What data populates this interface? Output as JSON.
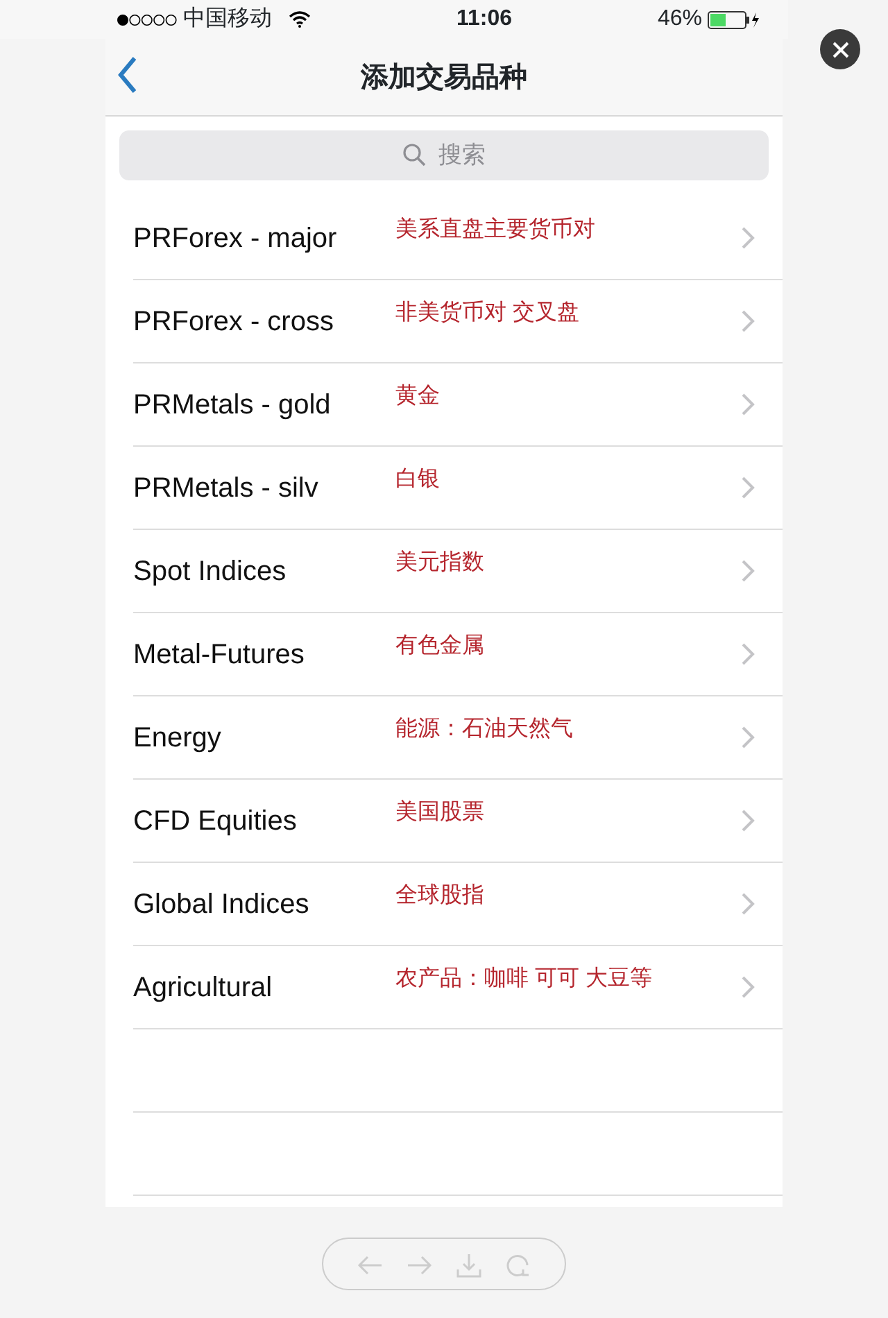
{
  "status_bar": {
    "carrier": "中国移动",
    "time": "11:06",
    "battery": "46%"
  },
  "nav_bar": {
    "title": "添加交易品种"
  },
  "search": {
    "placeholder": "搜索"
  },
  "instruments": [
    {
      "name": "PRForex - major",
      "note": "美系直盘主要货币对"
    },
    {
      "name": "PRForex - cross",
      "note": "非美货币对  交叉盘"
    },
    {
      "name": "PRMetals - gold",
      "note": "黄金"
    },
    {
      "name": "PRMetals - silv",
      "note": "白银"
    },
    {
      "name": "Spot Indices",
      "note": "美元指数"
    },
    {
      "name": "Metal-Futures",
      "note": "有色金属"
    },
    {
      "name": "Energy",
      "note": "能源：石油天然气"
    },
    {
      "name": "CFD Equities",
      "note": "美国股票"
    },
    {
      "name": "Global Indices",
      "note": "全球股指"
    },
    {
      "name": "Agricultural",
      "note": "农产品：咖啡  可可  大豆等"
    }
  ]
}
